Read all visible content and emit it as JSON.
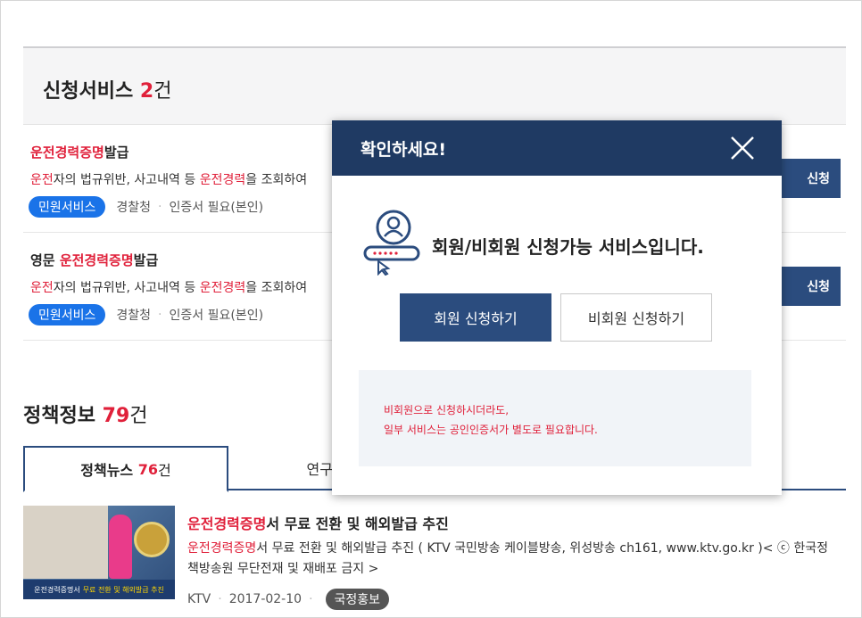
{
  "apply_section": {
    "title": "신청서비스",
    "count": "2",
    "count_unit": "건"
  },
  "services": [
    {
      "title_prefix": "",
      "title_highlight": "운전경력증명",
      "title_suffix": "발급",
      "desc_h1": "운전",
      "desc_t1": "자의 법규위반, 사고내역 등 ",
      "desc_h2": "운전경력",
      "desc_t2": "을 조회하여",
      "badge": "민원서비스",
      "agency": "경찰청",
      "cert": "인증서 필요(본인)",
      "apply_label": "신청"
    },
    {
      "title_prefix": "영문 ",
      "title_highlight": "운전경력증명",
      "title_suffix": "발급",
      "desc_h1": "운전",
      "desc_t1": "자의 법규위반, 사고내역 등 ",
      "desc_h2": "운전경력",
      "desc_t2": "을 조회하여",
      "badge": "민원서비스",
      "agency": "경찰청",
      "cert": "인증서 필요(본인)",
      "apply_label": "신청"
    }
  ],
  "policy_section": {
    "title": "정책정보",
    "count": "79",
    "count_unit": "건"
  },
  "tabs": {
    "news_label": "정책뉴스",
    "news_count": "76",
    "news_unit": "건",
    "research_label": "연구보고"
  },
  "news": {
    "title_highlight": "운전경력증명",
    "title_rest": "서 무료 전환 및 해외발급 추진",
    "desc_highlight": "운전경력증명",
    "desc_rest": "서 무료 전환 및 해외발급 추진 ( KTV 국민방송 케이블방송, 위성방송 ch161, www.ktv.go.kr )< ⓒ 한국정책방송원 무단전재 및 재배포 금지 >",
    "thumb_caption_white": "운전경력증명서",
    "thumb_caption_yellow": "무료 전환 및 해외발급 추진",
    "source": "KTV",
    "date": "2017-02-10",
    "tag": "국정홍보"
  },
  "modal": {
    "title": "확인하세요!",
    "message": "회원/비회원 신청가능 서비스입니다.",
    "member_button": "회원 신청하기",
    "guest_button": "비회원 신청하기",
    "notice_line1": "비회원으로 신청하시더라도,",
    "notice_line2": "일부 서비스는 공인인증서가 별도로 필요합니다."
  },
  "colors": {
    "accent_red": "#e0203a",
    "navy": "#1f3a63",
    "button_navy": "#2b4c7e",
    "badge_blue": "#1a73e8"
  }
}
